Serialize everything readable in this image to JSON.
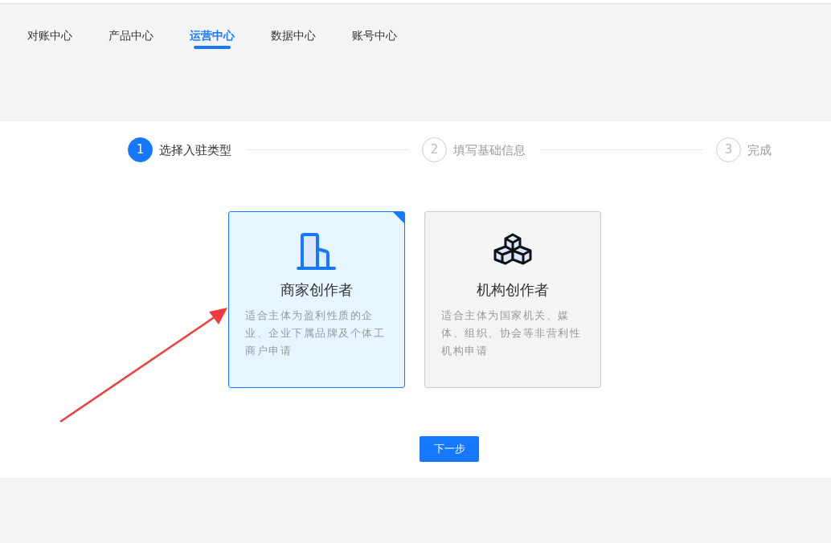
{
  "tabs": [
    {
      "label": "对账中心",
      "selected": false
    },
    {
      "label": "产品中心",
      "selected": false
    },
    {
      "label": "运营中心",
      "selected": true
    },
    {
      "label": "数据中心",
      "selected": false
    },
    {
      "label": "账号中心",
      "selected": false
    }
  ],
  "steps": [
    {
      "number": "1",
      "label": "选择入驻类型",
      "active": true
    },
    {
      "number": "2",
      "label": "填写基础信息",
      "active": false
    },
    {
      "number": "3",
      "label": "完成",
      "active": false
    }
  ],
  "cards": [
    {
      "kind": "building",
      "title": "商家创作者",
      "description": "适合主体为盈利性质的企业、企业下属品牌及个体工商户申请",
      "selected": true
    },
    {
      "kind": "cubes",
      "title": "机构创作者",
      "description": "适合主体为国家机关、媒体、组织、协会等非营利性机构申请",
      "selected": false
    }
  ],
  "next_button": "下一步"
}
